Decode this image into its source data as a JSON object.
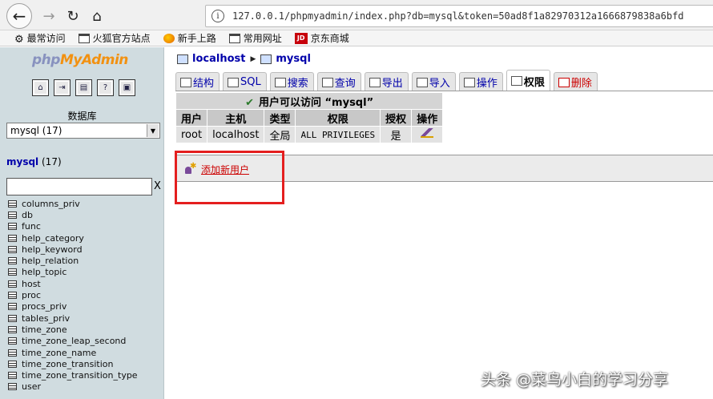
{
  "browser": {
    "url": "127.0.0.1/phpmyadmin/index.php?db=mysql&token=50ad8f1a82970312a1666879838a6bfd",
    "bookmarks": [
      {
        "label": "最常访问",
        "icon": "gear-icon"
      },
      {
        "label": "火狐官方站点",
        "icon": "folder-icon"
      },
      {
        "label": "新手上路",
        "icon": "firefox-icon"
      },
      {
        "label": "常用网址",
        "icon": "folder-icon"
      },
      {
        "label": "京东商城",
        "icon": "jd-icon",
        "badge": "JD"
      }
    ]
  },
  "sidebar": {
    "logo": {
      "php": "php",
      "my": "My",
      "admin": "Admin"
    },
    "database_label": "数据库",
    "selected_db": "mysql (17)",
    "db_name": "mysql",
    "db_count": "(17)",
    "filter_clear": "X",
    "tables": [
      "columns_priv",
      "db",
      "func",
      "help_category",
      "help_keyword",
      "help_relation",
      "help_topic",
      "host",
      "proc",
      "procs_priv",
      "tables_priv",
      "time_zone",
      "time_zone_leap_second",
      "time_zone_name",
      "time_zone_transition",
      "time_zone_transition_type",
      "user"
    ]
  },
  "breadcrumb": {
    "server": "localhost",
    "database": "mysql"
  },
  "tabs": [
    {
      "label": "结构",
      "icon": "structure-icon"
    },
    {
      "label": "SQL",
      "icon": "sql-icon"
    },
    {
      "label": "搜索",
      "icon": "search-icon"
    },
    {
      "label": "查询",
      "icon": "query-icon"
    },
    {
      "label": "导出",
      "icon": "export-icon"
    },
    {
      "label": "导入",
      "icon": "import-icon"
    },
    {
      "label": "操作",
      "icon": "operations-icon"
    },
    {
      "label": "权限",
      "icon": "privileges-icon",
      "active": true
    },
    {
      "label": "删除",
      "icon": "drop-icon"
    }
  ],
  "privileges": {
    "caption": "用户可以访问 “mysql”",
    "headers": [
      "用户",
      "主机",
      "类型",
      "权限",
      "授权",
      "操作"
    ],
    "rows": [
      [
        "root",
        "localhost",
        "全局",
        "ALL PRIVILEGES",
        "是"
      ]
    ]
  },
  "add_user": {
    "label": "添加新用户"
  },
  "watermark": "头条 @菜鸟小白的学习分享",
  "colors": {
    "link": "#0000aa",
    "danger": "#cc0000",
    "highlight": "#e41f1f",
    "sidebar_bg": "#d0dce0"
  }
}
